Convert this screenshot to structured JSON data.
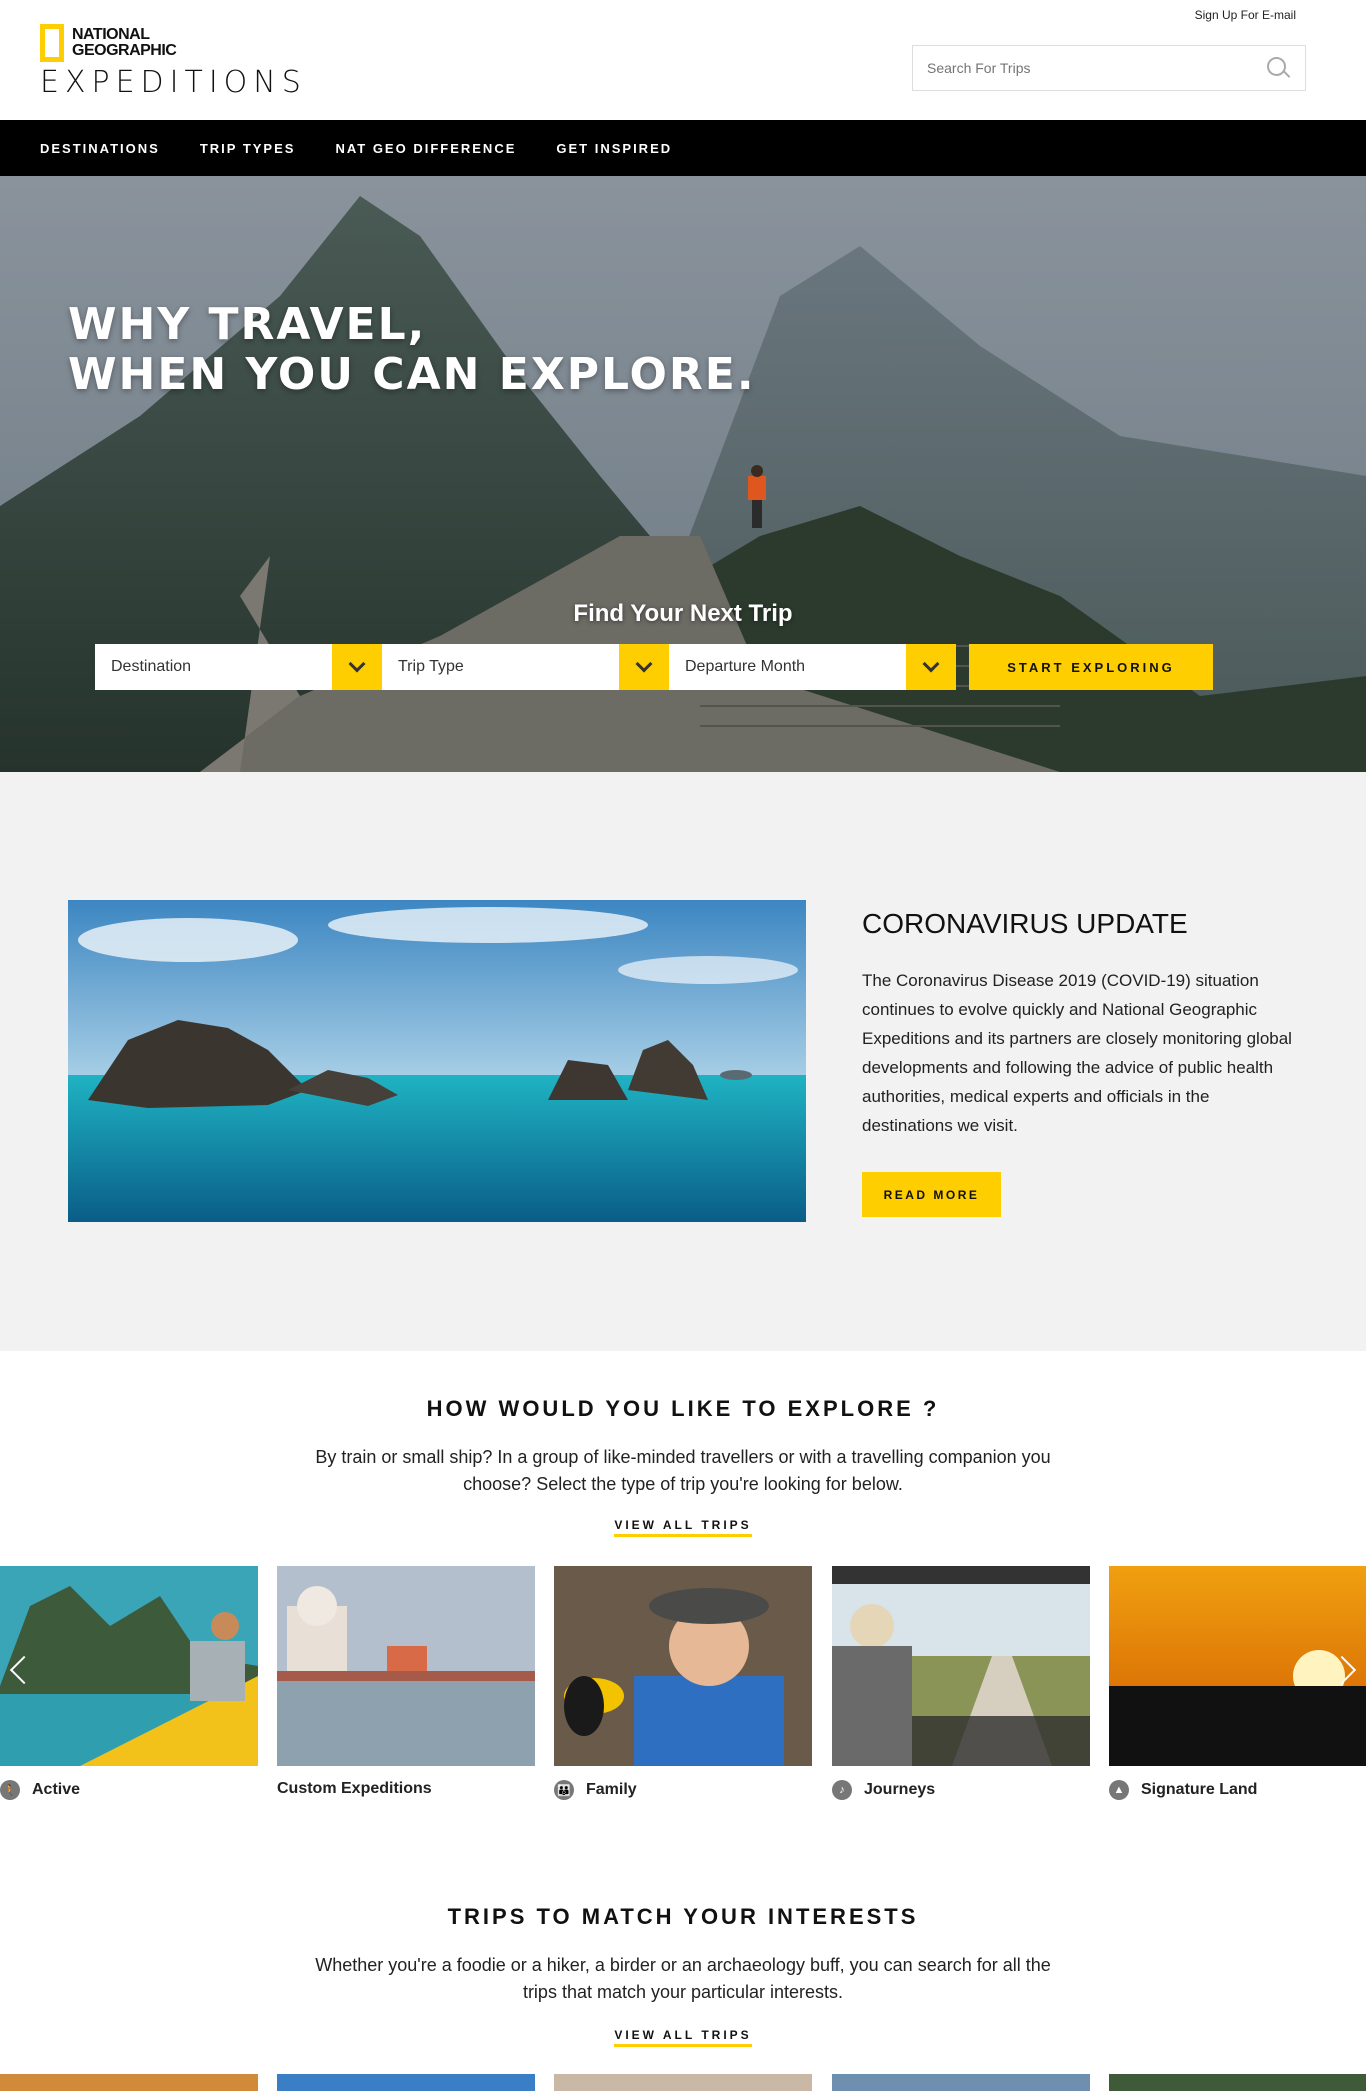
{
  "header": {
    "signup_label": "Sign Up For E-mail",
    "logo_line1": "NATIONAL",
    "logo_line2": "GEOGRAPHIC",
    "logo_line3": "EXPEDITIONS",
    "search_placeholder": "Search For Trips"
  },
  "nav": {
    "items": [
      {
        "label": "DESTINATIONS"
      },
      {
        "label": "TRIP TYPES"
      },
      {
        "label": "NAT GEO DIFFERENCE"
      },
      {
        "label": "GET INSPIRED"
      }
    ]
  },
  "hero": {
    "title_line1": "WHY TRAVEL,",
    "title_line2": "WHEN YOU CAN EXPLORE.",
    "find_title": "Find Your Next Trip",
    "select_destination": "Destination",
    "select_trip_type": "Trip Type",
    "select_departure": "Departure Month",
    "start_button": "START EXPLORING"
  },
  "covid": {
    "title": "CORONAVIRUS UPDATE",
    "text": "The Coronavirus Disease 2019 (COVID-19) situation continues to evolve quickly and National Geographic Expeditions and its partners are closely monitoring global developments and following the advice of public health authorities, medical experts and officials in the destinations we visit.",
    "button": "READ MORE"
  },
  "explore": {
    "title": "HOW WOULD YOU LIKE TO EXPLORE ?",
    "text": "By train or small ship? In a group of like-minded travellers or with a travelling companion you choose? Select the type of trip you're looking for below.",
    "view_all": "VIEW ALL TRIPS",
    "cards": [
      {
        "label": "Active",
        "icon": "hiker-icon"
      },
      {
        "label": "Custom Expeditions",
        "icon": ""
      },
      {
        "label": "Family",
        "icon": "family-icon"
      },
      {
        "label": "Journeys",
        "icon": "journeys-icon"
      },
      {
        "label": "Signature Land",
        "icon": "mountain-icon"
      }
    ]
  },
  "interests": {
    "title": "TRIPS TO MATCH YOUR INTERESTS",
    "text": "Whether you're a foodie or a hiker, a birder or an archaeology buff, you can search for all the trips that match your particular interests.",
    "view_all": "VIEW ALL TRIPS"
  },
  "colors": {
    "accent": "#ffce00",
    "nav_bg": "#000000",
    "section_bg": "#f2f2f2"
  }
}
